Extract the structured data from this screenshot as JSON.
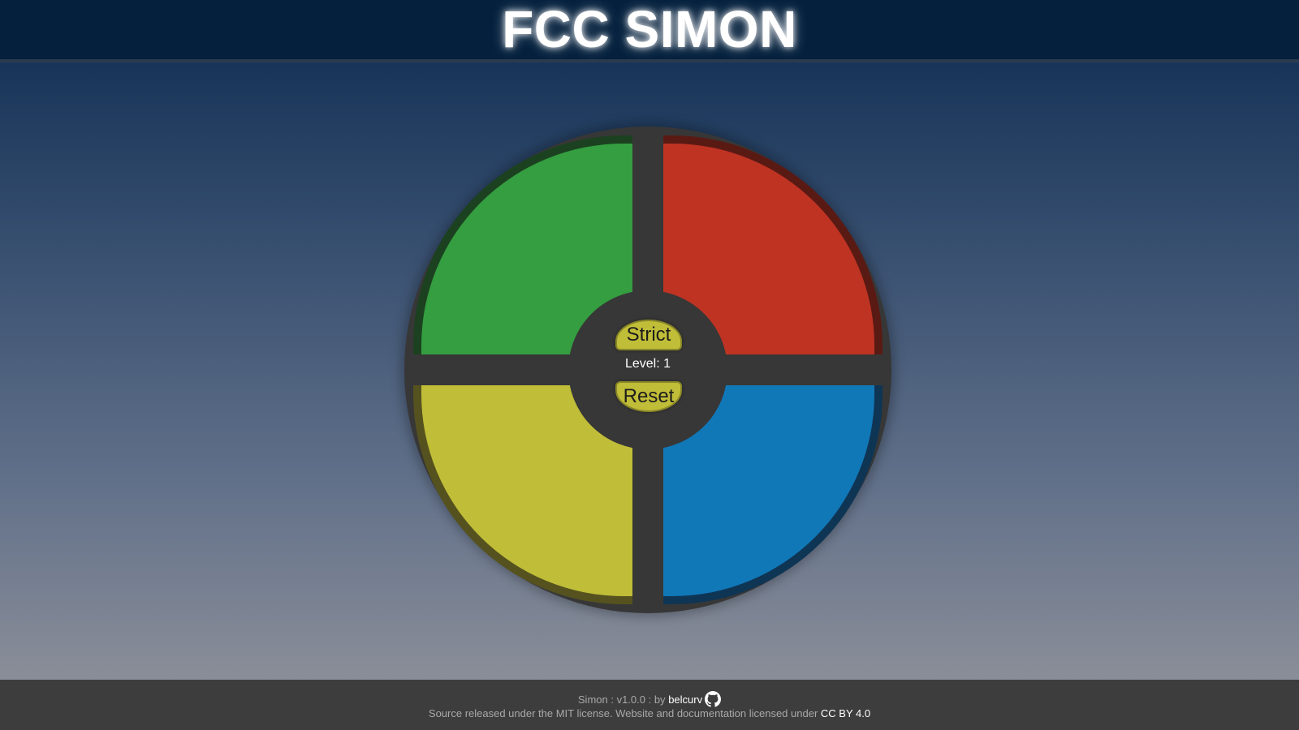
{
  "header": {
    "title": "FCC SIMON"
  },
  "game": {
    "pads": [
      {
        "name": "green",
        "color": "#349e40"
      },
      {
        "name": "red",
        "color": "#bf3323"
      },
      {
        "name": "yellow",
        "color": "#c0bd38"
      },
      {
        "name": "blue",
        "color": "#1178b8"
      }
    ],
    "strict_label": "Strict",
    "level_label": "Level: 1",
    "reset_label": "Reset"
  },
  "footer": {
    "version_prefix": "Simon : v1.0.0 : by",
    "author_link": "belcurv",
    "author_icon": "github-icon",
    "license_text": "Source released under the MIT license. Website and documentation licensed under",
    "license_link": "CC BY 4.0"
  }
}
